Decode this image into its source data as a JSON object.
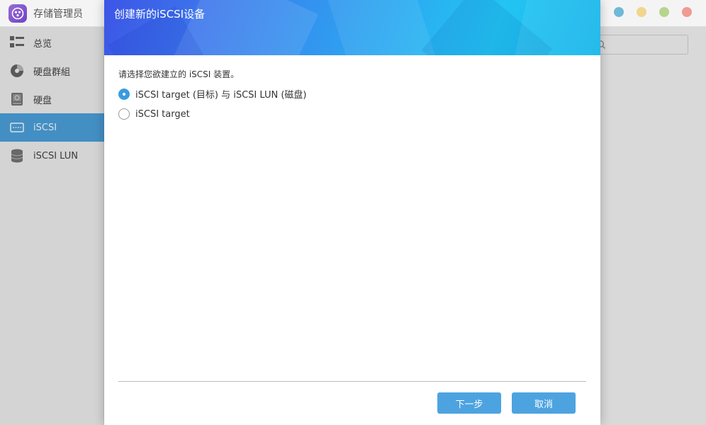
{
  "app": {
    "title": "存储管理员",
    "logo_icon": "app-logo-icon"
  },
  "sidebar": {
    "items": [
      {
        "label": "总览",
        "icon": "overview-grid-icon"
      },
      {
        "label": "硬盘群組",
        "icon": "disk-group-icon"
      },
      {
        "label": "硬盘",
        "icon": "hard-disk-icon"
      },
      {
        "label": "iSCSI",
        "icon": "iscsi-icon",
        "active": true
      },
      {
        "label": "iSCSI LUN",
        "icon": "database-icon"
      }
    ]
  },
  "window_controls": [
    "#6fb8d8",
    "#f2d58e",
    "#b7d58c",
    "#ef9a93"
  ],
  "modal": {
    "title": "创建新的iSCSI设备",
    "prompt": "请选择您欲建立的 iSCSI 装置。",
    "options": [
      {
        "label": "iSCSI target (目标) 与 iSCSI LUN (磁盘)",
        "checked": true
      },
      {
        "label": "iSCSI target",
        "checked": false
      }
    ],
    "buttons": {
      "next": "下一步",
      "cancel": "取消"
    }
  },
  "colors": {
    "accent": "#4da3e0",
    "radio_selected": "#3b9be0"
  }
}
